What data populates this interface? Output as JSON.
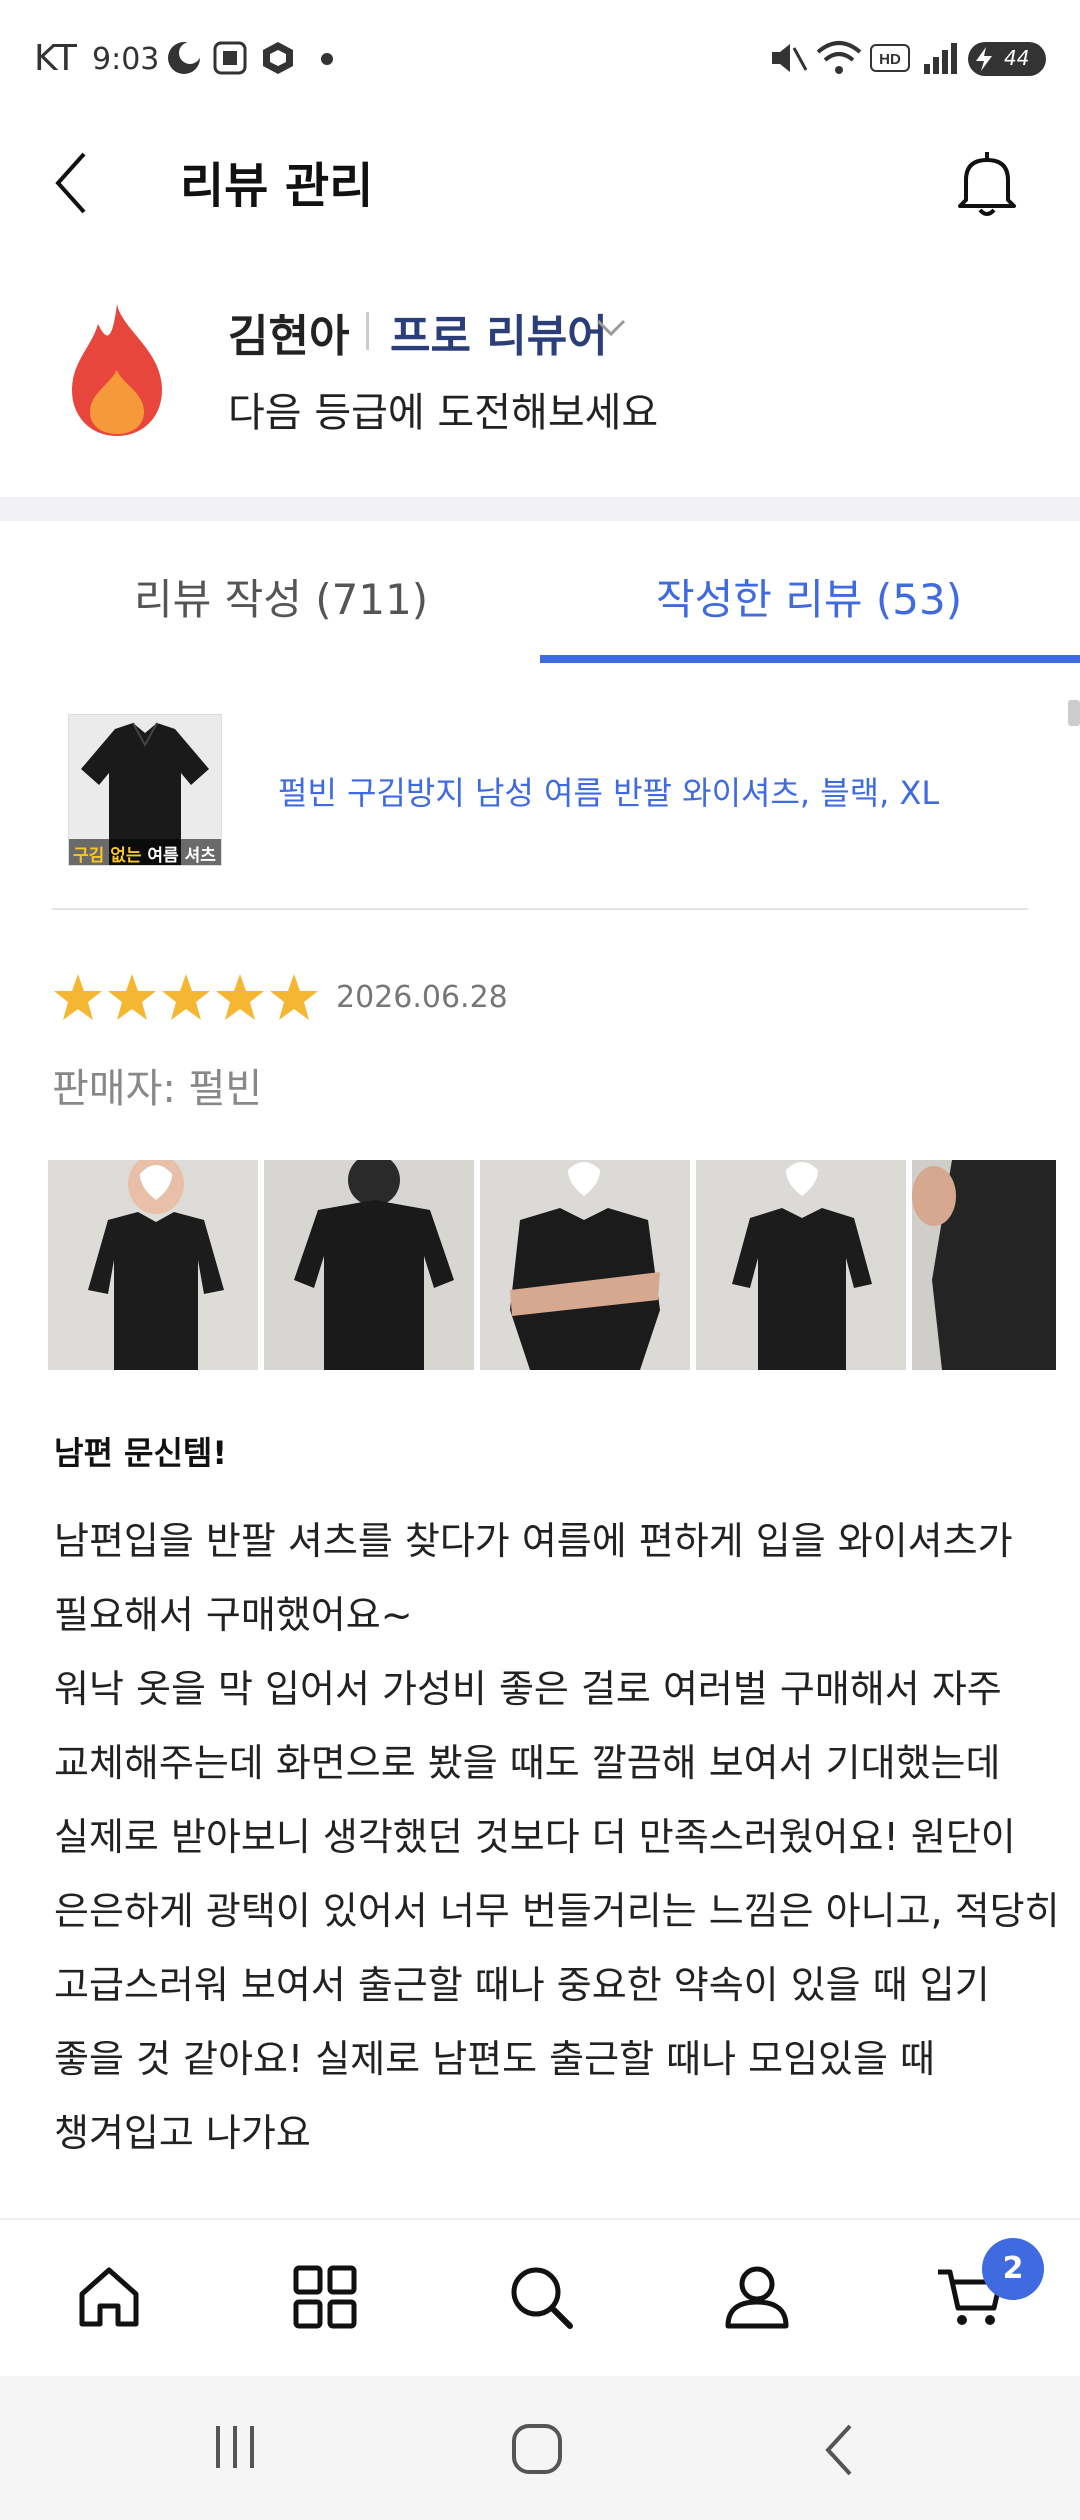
{
  "status_bar": {
    "carrier": "KT",
    "time": "9:03",
    "battery": "44"
  },
  "header": {
    "title": "리뷰 관리"
  },
  "profile": {
    "name": "김현아",
    "grade": "프로 리뷰어",
    "next_level_text": "다음 등급에 도전해보세요"
  },
  "tabs": [
    {
      "label": "리뷰 작성 (711)",
      "active": false
    },
    {
      "label": "작성한 리뷰 (53)",
      "active": true
    }
  ],
  "product": {
    "name": "펄빈 구김방지 남성 여름 반팔 와이셔츠, 블랙, XL",
    "thumb_caption_a": "구김 없는",
    "thumb_caption_b": " 여름 셔츠"
  },
  "review": {
    "rating": 5,
    "date": "2026.06.28",
    "seller": "판매자: 펄빈",
    "title": "남편 문신템!",
    "body_lines": [
      "남편입을 반팔 셔츠를 찾다가 여름에 편하게 입을 와이셔츠가",
      "필요해서 구매했어요~",
      "워낙 옷을 막 입어서 가성비 좋은 걸로 여러벌 구매해서 자주",
      "교체해주는데 화면으로 봤을 때도 깔끔해 보여서 기대했는데",
      "실제로 받아보니 생각했던 것보다 더 만족스러웠어요! 원단이",
      "은은하게 광택이 있어서 너무 번들거리는 느낌은 아니고, 적당히",
      "고급스러워 보여서 출근할 때나 중요한 약속이 있을 때 입기",
      "좋을 것 같아요! 실제로 남편도 출근할 때나 모임있을 때",
      "챙겨입고 나가요"
    ]
  },
  "bottom_nav": {
    "items": [
      "home-icon",
      "category-icon",
      "search-icon",
      "profile-icon",
      "cart-icon"
    ],
    "cart_count": "2"
  },
  "colors": {
    "accent": "#3f6ae0",
    "grade": "#2c3e7a",
    "star": "#f5b731"
  }
}
